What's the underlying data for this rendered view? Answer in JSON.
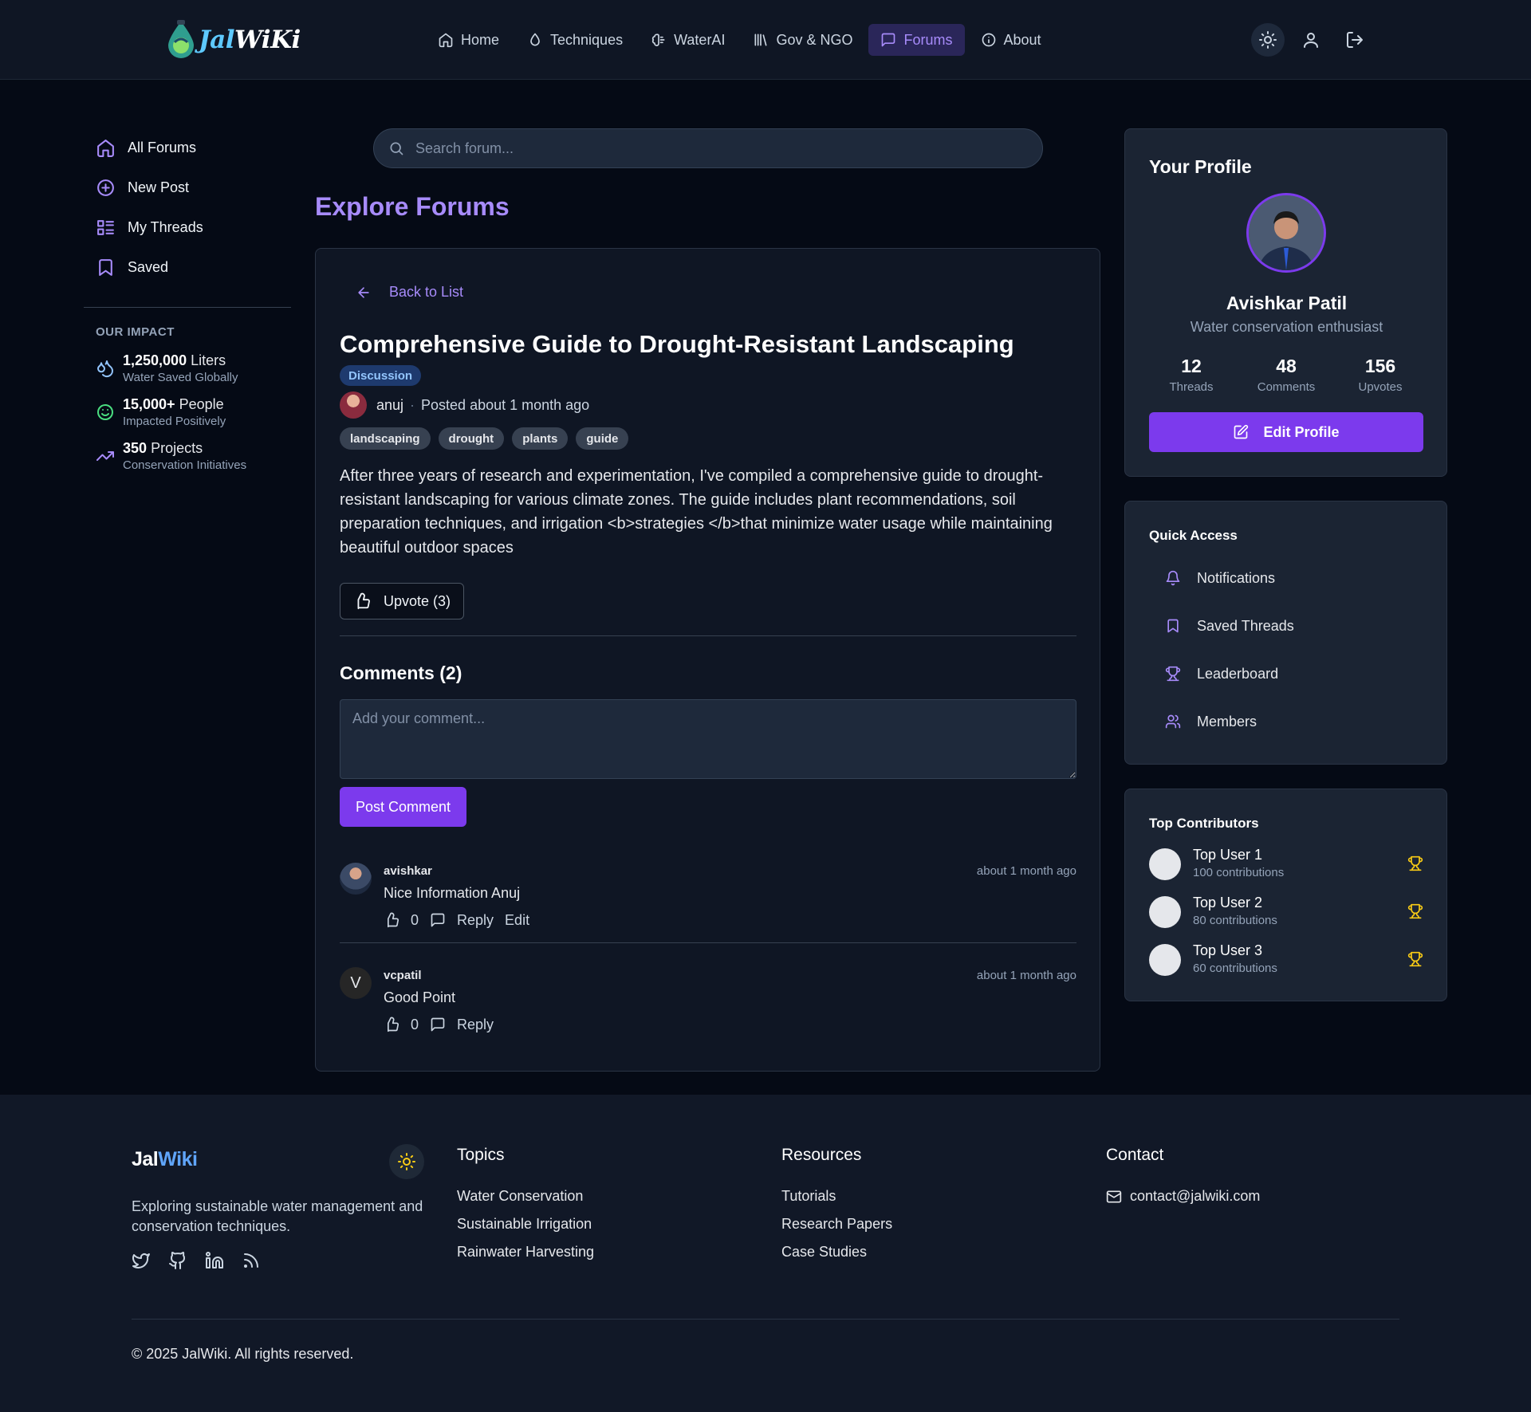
{
  "header": {
    "logo_prefix": "Jal",
    "logo_suffix": "WiKi",
    "nav": [
      {
        "label": "Home",
        "icon": "home-icon"
      },
      {
        "label": "Techniques",
        "icon": "droplet-icon"
      },
      {
        "label": "WaterAI",
        "icon": "brain-icon"
      },
      {
        "label": "Gov & NGO",
        "icon": "library-icon"
      },
      {
        "label": "Forums",
        "icon": "message-icon",
        "active": true
      },
      {
        "label": "About",
        "icon": "info-icon"
      }
    ]
  },
  "sidebar": {
    "items": [
      {
        "label": "All Forums",
        "icon": "home-icon"
      },
      {
        "label": "New Post",
        "icon": "plus-circle-icon"
      },
      {
        "label": "My Threads",
        "icon": "list-icon"
      },
      {
        "label": "Saved",
        "icon": "bookmark-icon"
      }
    ],
    "impact_title": "OUR IMPACT",
    "impact": [
      {
        "value": "1,250,000",
        "unit": "Liters",
        "caption": "Water Saved Globally"
      },
      {
        "value": "15,000+",
        "unit": "People",
        "caption": "Impacted Positively"
      },
      {
        "value": "350",
        "unit": "Projects",
        "caption": "Conservation Initiatives"
      }
    ]
  },
  "search": {
    "placeholder": "Search forum..."
  },
  "main": {
    "heading": "Explore Forums",
    "back_label": "Back to List",
    "post": {
      "title": "Comprehensive Guide to Drought-Resistant Landscaping",
      "category": "Discussion",
      "author": "anuj",
      "posted": "Posted about 1 month ago",
      "tags": [
        "landscaping",
        "drought",
        "plants",
        "guide"
      ],
      "body": "After three years of research and experimentation, I've compiled a comprehensive guide to drought-resistant landscaping for various climate zones. The guide includes plant recommendations, soil preparation techniques, and irrigation <b>strategies </b>that minimize water usage while maintaining beautiful outdoor spaces",
      "upvote_label": "Upvote (3)"
    },
    "comments_title": "Comments (2)",
    "comment_placeholder": "Add your comment...",
    "post_comment_label": "Post Comment",
    "comments": [
      {
        "user": "avishkar",
        "time": "about 1 month ago",
        "text": "Nice Information Anuj",
        "likes": "0",
        "reply": "Reply",
        "edit": "Edit"
      },
      {
        "user": "vcpatil",
        "initial": "V",
        "time": "about 1 month ago",
        "text": "Good Point",
        "likes": "0",
        "reply": "Reply"
      }
    ]
  },
  "profile": {
    "title": "Your Profile",
    "name": "Avishkar Patil",
    "subtitle": "Water conservation enthusiast",
    "stats": [
      {
        "value": "12",
        "label": "Threads"
      },
      {
        "value": "48",
        "label": "Comments"
      },
      {
        "value": "156",
        "label": "Upvotes"
      }
    ],
    "edit_label": "Edit Profile"
  },
  "quick_access": {
    "title": "Quick Access",
    "items": [
      {
        "label": "Notifications",
        "icon": "bell-icon"
      },
      {
        "label": "Saved Threads",
        "icon": "bookmark-icon"
      },
      {
        "label": "Leaderboard",
        "icon": "trophy-icon"
      },
      {
        "label": "Members",
        "icon": "users-icon"
      }
    ]
  },
  "top_contributors": {
    "title": "Top Contributors",
    "users": [
      {
        "name": "Top User 1",
        "count": "100 contributions"
      },
      {
        "name": "Top User 2",
        "count": "80 contributions"
      },
      {
        "name": "Top User 3",
        "count": "60 contributions"
      }
    ]
  },
  "footer": {
    "logo_prefix": "Jal",
    "logo_suffix": "Wiki",
    "description": "Exploring sustainable water management and conservation techniques.",
    "topics_title": "Topics",
    "topics": [
      "Water Conservation",
      "Sustainable Irrigation",
      "Rainwater Harvesting"
    ],
    "resources_title": "Resources",
    "resources": [
      "Tutorials",
      "Research Papers",
      "Case Studies"
    ],
    "contact_title": "Contact",
    "email": "contact@jalwiki.com",
    "copyright": "© 2025 JalWiki. All rights reserved."
  },
  "colors": {
    "accent": "#7c3aed",
    "accent_text": "#a78bfa",
    "background": "#050a15",
    "card": "#0f1624",
    "panel": "#1b2433",
    "trophy": "#facc15"
  }
}
